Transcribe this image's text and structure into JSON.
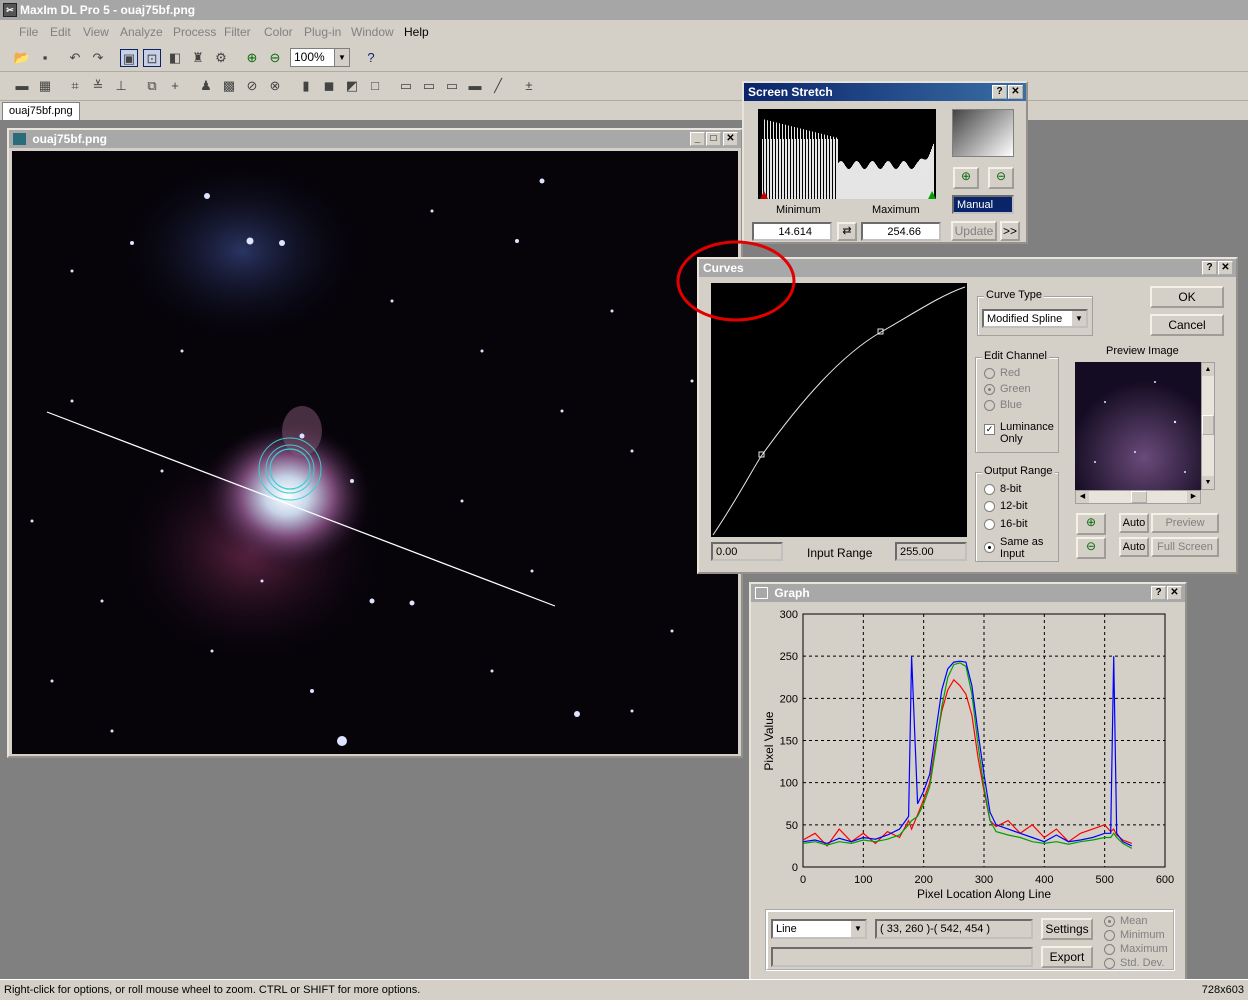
{
  "app": {
    "title": "MaxIm DL Pro 5 - ouaj75bf.png"
  },
  "menu": [
    "File",
    "Edit",
    "View",
    "Analyze",
    "Process",
    "Filter",
    "Color",
    "Plug-in",
    "Window",
    "Help"
  ],
  "toolbar": {
    "zoom_value": "100%"
  },
  "tabs": [
    {
      "label": "ouaj75bf.png"
    }
  ],
  "image_window": {
    "title": "ouaj75bf.png"
  },
  "screen_stretch": {
    "title": "Screen Stretch",
    "minimum_label": "Minimum",
    "maximum_label": "Maximum",
    "minimum_value": "14.614",
    "maximum_value": "254.66",
    "mode": "Manual",
    "update_label": "Update",
    "more_label": ">>"
  },
  "curves": {
    "title": "Curves",
    "curve_type_label": "Curve Type",
    "curve_type_value": "Modified Spline",
    "ok_label": "OK",
    "cancel_label": "Cancel",
    "edit_channel_label": "Edit Channel",
    "channels": [
      "Red",
      "Green",
      "Blue"
    ],
    "selected_channel": "Green",
    "luminance_label": "Luminance Only",
    "luminance_checked": true,
    "output_range_label": "Output Range",
    "output_ranges": [
      "8-bit",
      "12-bit",
      "16-bit",
      "Same as Input"
    ],
    "selected_output": "Same as Input",
    "preview_image_label": "Preview Image",
    "input_min": "0.00",
    "input_max": "255.00",
    "input_range_label": "Input Range",
    "auto_label": "Auto",
    "preview_label": "Preview",
    "full_screen_label": "Full Screen"
  },
  "graph": {
    "title": "Graph",
    "mode_value": "Line",
    "coords": "( 33, 260 )-( 542, 454 )",
    "settings_label": "Settings",
    "export_label": "Export",
    "stats": [
      "Mean",
      "Minimum",
      "Maximum",
      "Std. Dev."
    ],
    "selected_stat": "Mean"
  },
  "chart_data": {
    "type": "line",
    "xlabel": "Pixel Location Along Line",
    "ylabel": "Pixel Value",
    "xlim": [
      0,
      600
    ],
    "ylim": [
      0,
      300
    ],
    "xticks": [
      0,
      100,
      200,
      300,
      400,
      500,
      600
    ],
    "yticks": [
      0,
      50,
      100,
      150,
      200,
      250,
      300
    ],
    "grid": true,
    "x": [
      0,
      20,
      40,
      60,
      80,
      100,
      120,
      140,
      160,
      175,
      180,
      190,
      200,
      210,
      220,
      230,
      240,
      250,
      260,
      270,
      280,
      290,
      300,
      310,
      320,
      340,
      360,
      380,
      400,
      420,
      440,
      460,
      480,
      500,
      510,
      515,
      520,
      530,
      545
    ],
    "series": [
      {
        "color": "#0000ff",
        "values": [
          30,
          32,
          28,
          34,
          30,
          35,
          33,
          38,
          45,
          60,
          250,
          75,
          90,
          110,
          160,
          210,
          235,
          243,
          244,
          243,
          215,
          160,
          110,
          65,
          50,
          45,
          40,
          35,
          30,
          38,
          30,
          32,
          35,
          40,
          40,
          250,
          40,
          30,
          25
        ]
      },
      {
        "color": "#00a000",
        "values": [
          28,
          30,
          26,
          30,
          28,
          32,
          30,
          33,
          38,
          50,
          55,
          60,
          75,
          95,
          140,
          190,
          225,
          240,
          242,
          238,
          205,
          145,
          95,
          55,
          42,
          38,
          35,
          30,
          28,
          30,
          27,
          30,
          32,
          35,
          35,
          40,
          35,
          28,
          22
        ]
      },
      {
        "color": "#ff0000",
        "values": [
          32,
          40,
          25,
          45,
          30,
          40,
          28,
          42,
          35,
          55,
          45,
          62,
          80,
          100,
          145,
          185,
          210,
          222,
          215,
          205,
          180,
          130,
          90,
          55,
          48,
          55,
          40,
          50,
          35,
          45,
          30,
          40,
          45,
          50,
          42,
          45,
          38,
          32,
          28
        ]
      }
    ]
  },
  "status": {
    "hint": "Right-click for options, or roll mouse wheel to zoom. CTRL or SHIFT for more options.",
    "size": "728x603"
  }
}
